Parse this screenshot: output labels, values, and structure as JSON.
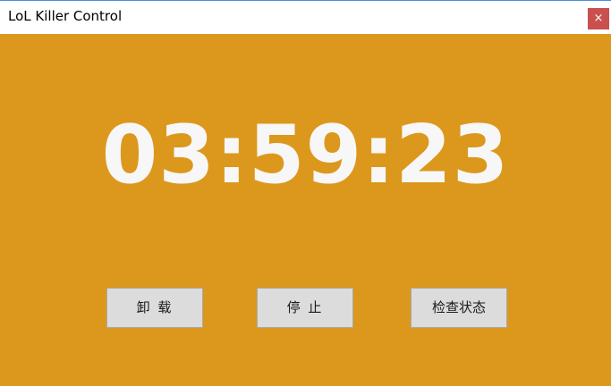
{
  "window": {
    "title": "LoL Killer Control",
    "close_label": "×"
  },
  "main": {
    "timer": "03:59:23",
    "buttons": {
      "unload": "卸 载",
      "stop": "停 止",
      "check_status": "检查状态"
    }
  },
  "colors": {
    "background": "#dc981d",
    "close_button": "#c9504f",
    "button_face": "#dcdcdc",
    "timer_text": "#f7f7f7"
  },
  "icons": {
    "close": "close-icon"
  }
}
